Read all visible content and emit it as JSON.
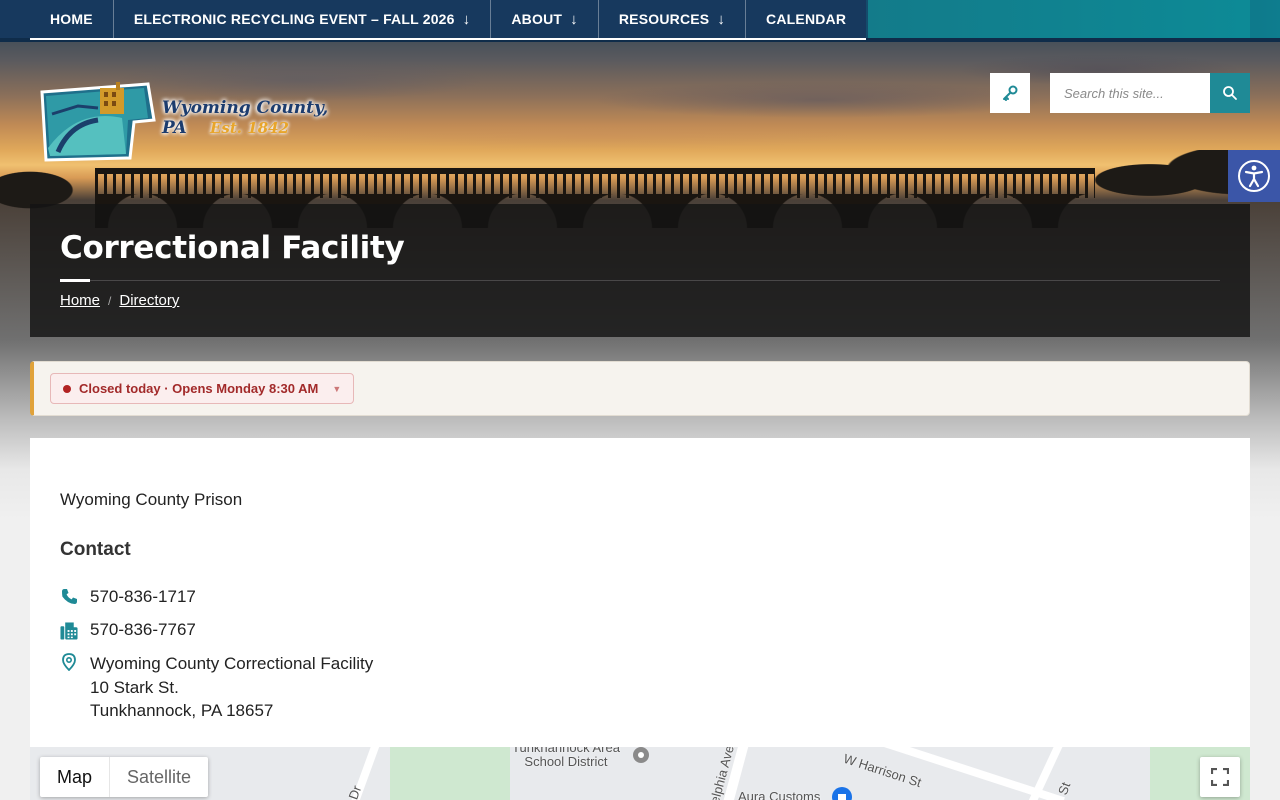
{
  "nav": {
    "items": [
      {
        "label": "HOME",
        "has_dropdown": false
      },
      {
        "label": "ELECTRONIC RECYCLING EVENT – FALL 2026",
        "has_dropdown": true
      },
      {
        "label": "ABOUT",
        "has_dropdown": true
      },
      {
        "label": "RESOURCES",
        "has_dropdown": true
      },
      {
        "label": "CALENDAR",
        "has_dropdown": false
      }
    ]
  },
  "logo": {
    "name": "Wyoming County, PA",
    "established": "Est. 1842"
  },
  "search": {
    "placeholder": "Search this site..."
  },
  "page": {
    "title": "Correctional Facility",
    "breadcrumb": [
      {
        "label": "Home"
      },
      {
        "label": "Directory"
      }
    ]
  },
  "status": {
    "text": "Closed today · Opens Monday 8:30 AM"
  },
  "listing": {
    "org_name": "Wyoming County Prison",
    "contact_heading": "Contact",
    "phone": "570-836-1717",
    "fax": "570-836-7767",
    "address": {
      "line1": "Wyoming County Correctional Facility",
      "line2": "10 Stark St.",
      "line3": "Tunkhannock, PA 18657"
    }
  },
  "map": {
    "toggle_map": "Map",
    "toggle_satellite": "Satellite",
    "labels": {
      "school": "Tunkhannock Area\nSchool District",
      "street1": "W Harrison St",
      "street2": "elphia Ave",
      "poi": "Aura Customs",
      "dr": "Dr",
      "st": "St"
    }
  },
  "colors": {
    "nav_bg": "#17395e",
    "accent_teal": "#1f8a96",
    "status_red": "#b22222",
    "status_border": "#e0a23a",
    "a11y_blue": "#3b56a8"
  },
  "icons": {
    "login": "key-icon",
    "search": "search-icon",
    "accessibility": "accessibility-icon",
    "phone": "phone-icon",
    "fax": "fax-icon",
    "address": "map-pin-icon",
    "fullscreen": "fullscreen-icon"
  }
}
